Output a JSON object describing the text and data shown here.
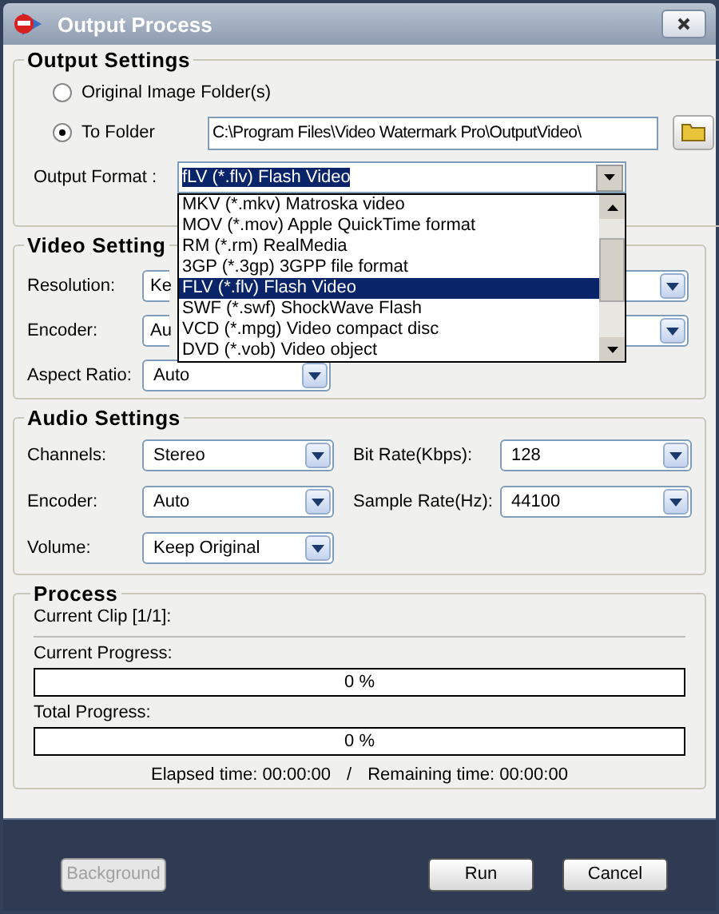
{
  "window": {
    "title": "Output Process"
  },
  "output_settings": {
    "title": "Output Settings",
    "options": [
      {
        "label": "Original Image Folder(s)",
        "selected": false
      },
      {
        "label": "To Folder",
        "selected": true
      }
    ],
    "folder": "C:\\Program Files\\Video Watermark Pro\\OutputVideo\\",
    "format_label": "Output Format :",
    "format_value": "fLV  (*.flv) Flash Video",
    "format_list": [
      {
        "label": "MKV  (*.mkv) Matroska video",
        "selected": false
      },
      {
        "label": "MOV  (*.mov) Apple QuickTime format",
        "selected": false
      },
      {
        "label": "RM    (*.rm) RealMedia",
        "selected": false
      },
      {
        "label": "3GP  (*.3gp) 3GPP file format",
        "selected": false
      },
      {
        "label": "FLV  (*.flv) Flash Video",
        "selected": true
      },
      {
        "label": "SWF  (*.swf) ShockWave Flash",
        "selected": false
      },
      {
        "label": "VCD  (*.mpg) Video compact disc",
        "selected": false
      },
      {
        "label": "DVD  (*.vob) Video object",
        "selected": false
      }
    ]
  },
  "video_settings": {
    "title": "Video Setting",
    "fields": [
      {
        "label": "Resolution:",
        "value": "Ke",
        "kind": "covered"
      },
      {
        "label": "Encoder:",
        "value": "Au",
        "kind": "covered"
      },
      {
        "label": "Aspect Ratio:",
        "value": "Auto",
        "kind": "full"
      }
    ]
  },
  "audio_settings": {
    "title": "Audio Settings",
    "rows": [
      {
        "label": "Channels:",
        "value": "Stereo",
        "right_label": "Bit Rate(Kbps):",
        "right_value": "128"
      },
      {
        "label": "Encoder:",
        "value": "Auto",
        "right_label": "Sample Rate(Hz):",
        "right_value": "44100"
      },
      {
        "label": "Volume:",
        "value": "Keep Original"
      }
    ]
  },
  "process": {
    "title": "Process",
    "clip_label": "Current Clip [1/1]:",
    "bars": [
      {
        "label": "Current Progress:",
        "text": "0 %",
        "level": 0
      },
      {
        "label": "Total Progress:",
        "text": "0 %",
        "level": 0
      }
    ],
    "elapsed": "Elapsed time: 00:00:00",
    "separator": "/",
    "remaining": "Remaining time: 00:00:00"
  },
  "buttons": [
    {
      "label": "Background",
      "disabled": true
    },
    {
      "label": "Run",
      "disabled": false
    },
    {
      "label": "Cancel",
      "disabled": false
    }
  ]
}
